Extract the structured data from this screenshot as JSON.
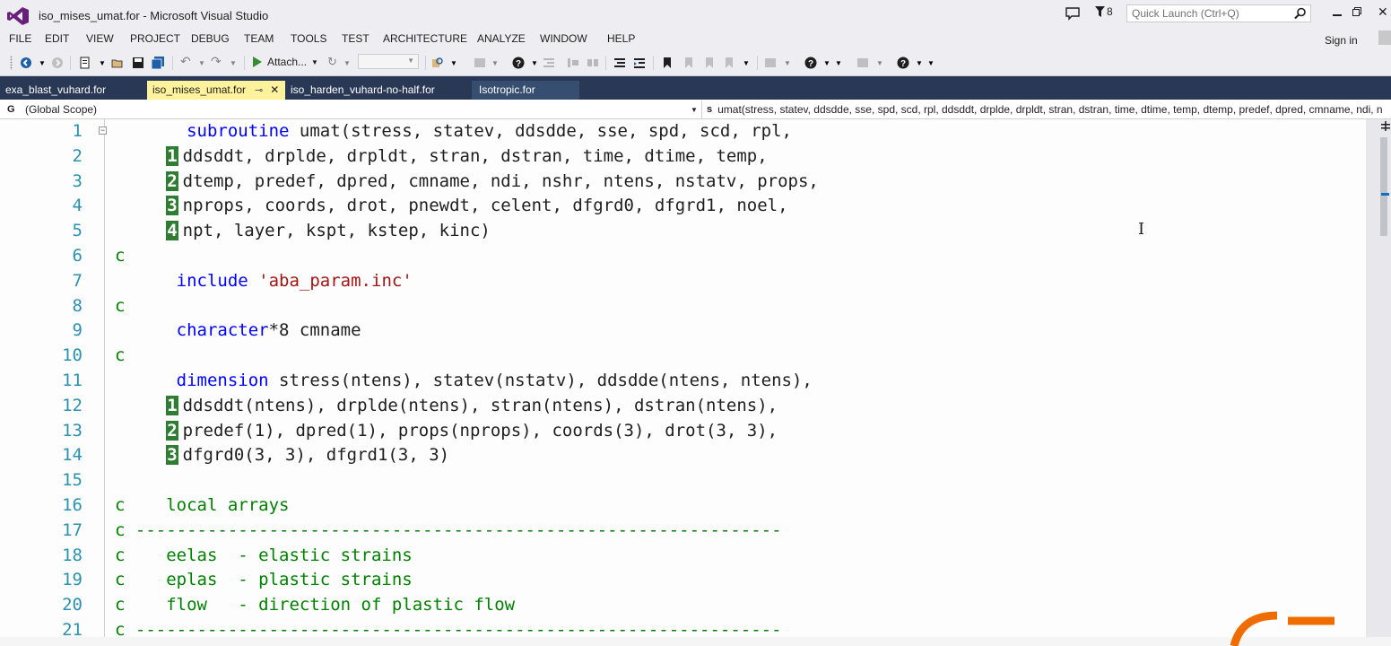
{
  "window": {
    "title": "iso_mises_umat.for - Microsoft Visual Studio",
    "filter_count": "8",
    "quick_launch_placeholder": "Quick Launch (Ctrl+Q)",
    "sign_in": "Sign in"
  },
  "menu": [
    "FILE",
    "EDIT",
    "VIEW",
    "PROJECT",
    "DEBUG",
    "TEAM",
    "TOOLS",
    "TEST",
    "ARCHITECTURE",
    "ANALYZE",
    "WINDOW",
    "HELP"
  ],
  "toolbar": {
    "attach_label": "Attach..."
  },
  "tabs": [
    {
      "label": "exa_blast_vuhard.for",
      "active": false
    },
    {
      "label": "iso_mises_umat.for",
      "active": true
    },
    {
      "label": "iso_harden_vuhard-no-half.for",
      "active": false
    },
    {
      "label": "Isotropic.for",
      "active": false
    }
  ],
  "navbar": {
    "scope_icon": "G",
    "scope": "(Global Scope)",
    "member_icon": "s",
    "member": "umat(stress, statev, ddsdde, sse, spd, scd, rpl, ddsddt, drplde, drpldt, stran, dstran, time, dtime, temp, dtemp, predef, dpred, cmname, ndi, n"
  },
  "colors": {
    "keyword": "#0000ff",
    "string": "#a31515",
    "comment": "#008000",
    "line_number": "#2b91af",
    "continuation_bg": "#2e7d32",
    "tab_active_bg": "#fff29d",
    "tab_strip_bg": "#293955"
  },
  "code": {
    "lines": [
      {
        "n": "1",
        "parts": [
          {
            "t": "       "
          },
          {
            "t": "subroutine",
            "c": "kw"
          },
          {
            "t": " umat(stress, statev, ddsdde, sse, spd, scd, rpl,"
          }
        ]
      },
      {
        "n": "2",
        "parts": [
          {
            "t": "     "
          },
          {
            "t": "1",
            "c": "cont"
          },
          {
            "t": "ddsddt, drplde, drpldt, stran, dstran, time, dtime, temp,"
          }
        ]
      },
      {
        "n": "3",
        "parts": [
          {
            "t": "     "
          },
          {
            "t": "2",
            "c": "cont"
          },
          {
            "t": "dtemp, predef, dpred, cmname, ndi, nshr, ntens, nstatv, props,"
          }
        ]
      },
      {
        "n": "4",
        "parts": [
          {
            "t": "     "
          },
          {
            "t": "3",
            "c": "cont"
          },
          {
            "t": "nprops, coords, drot, pnewdt, celent, dfgrd0, dfgrd1, noel,"
          }
        ]
      },
      {
        "n": "5",
        "parts": [
          {
            "t": "     "
          },
          {
            "t": "4",
            "c": "cont"
          },
          {
            "t": "npt, layer, kspt, kstep, kinc)"
          }
        ]
      },
      {
        "n": "6",
        "parts": [
          {
            "t": "c",
            "c": "cmt"
          }
        ]
      },
      {
        "n": "7",
        "parts": [
          {
            "t": "      "
          },
          {
            "t": "include",
            "c": "kw"
          },
          {
            "t": " "
          },
          {
            "t": "'aba_param.inc'",
            "c": "str"
          }
        ]
      },
      {
        "n": "8",
        "parts": [
          {
            "t": "c",
            "c": "cmt"
          }
        ]
      },
      {
        "n": "9",
        "parts": [
          {
            "t": "      "
          },
          {
            "t": "character",
            "c": "kw"
          },
          {
            "t": "*8 cmname"
          }
        ]
      },
      {
        "n": "10",
        "parts": [
          {
            "t": "c",
            "c": "cmt"
          }
        ]
      },
      {
        "n": "11",
        "parts": [
          {
            "t": "      "
          },
          {
            "t": "dimension",
            "c": "kw"
          },
          {
            "t": " stress(ntens), statev(nstatv), ddsdde(ntens, ntens),"
          }
        ]
      },
      {
        "n": "12",
        "parts": [
          {
            "t": "     "
          },
          {
            "t": "1",
            "c": "cont"
          },
          {
            "t": "ddsddt(ntens), drplde(ntens), stran(ntens), dstran(ntens),"
          }
        ]
      },
      {
        "n": "13",
        "parts": [
          {
            "t": "     "
          },
          {
            "t": "2",
            "c": "cont"
          },
          {
            "t": "predef(1), dpred(1), props(nprops), coords(3), drot(3, 3),"
          }
        ]
      },
      {
        "n": "14",
        "parts": [
          {
            "t": "     "
          },
          {
            "t": "3",
            "c": "cont"
          },
          {
            "t": "dfgrd0(3, 3), dfgrd1(3, 3)"
          }
        ]
      },
      {
        "n": "15",
        "parts": []
      },
      {
        "n": "16",
        "parts": [
          {
            "t": "c    local arrays",
            "c": "cmt"
          }
        ]
      },
      {
        "n": "17",
        "parts": [
          {
            "t": "c ---------------------------------------------------------------",
            "c": "cmt"
          }
        ]
      },
      {
        "n": "18",
        "parts": [
          {
            "t": "c    eelas  - elastic strains",
            "c": "cmt"
          }
        ]
      },
      {
        "n": "19",
        "parts": [
          {
            "t": "c    eplas  - plastic strains",
            "c": "cmt"
          }
        ]
      },
      {
        "n": "20",
        "parts": [
          {
            "t": "c    flow   - direction of plastic flow",
            "c": "cmt"
          }
        ]
      },
      {
        "n": "21",
        "parts": [
          {
            "t": "c ---------------------------------------------------------------",
            "c": "cmt"
          }
        ]
      }
    ]
  }
}
